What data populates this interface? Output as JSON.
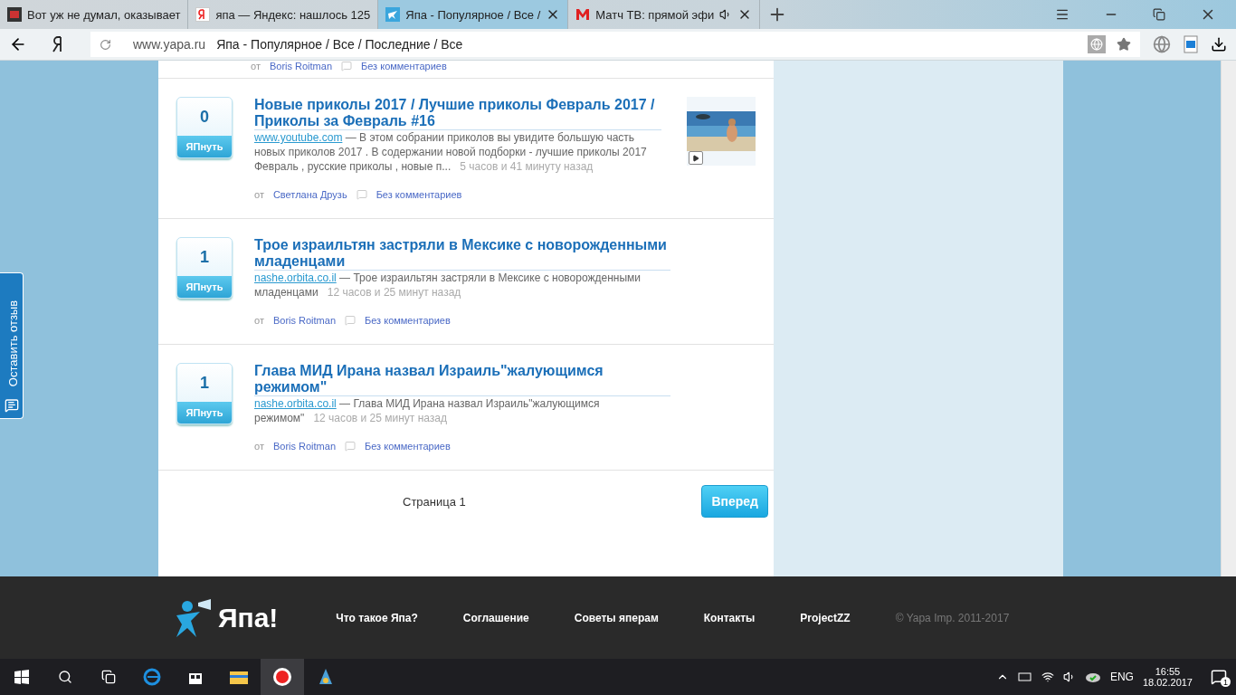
{
  "tabs": [
    {
      "title": "Вот уж не думал, оказывает",
      "selected": false,
      "kind": "yapa-dark"
    },
    {
      "title": "япа — Яндекс: нашлось 125",
      "selected": false,
      "kind": "yandex"
    },
    {
      "title": "Япа - Популярное / Все /",
      "selected": true,
      "kind": "yapa"
    },
    {
      "title": "Матч ТВ: прямой эфи",
      "selected": false,
      "kind": "match",
      "audio": true
    }
  ],
  "address": {
    "host": "www.yapa.ru",
    "title": "Япа - Популярное / Все / Последние / Все"
  },
  "top_meta": {
    "by": "от",
    "author": "Boris Roitman",
    "comments": "Без комментариев"
  },
  "posts": [
    {
      "votes": "0",
      "vote_label": "ЯПнуть",
      "title": "Новые приколы 2017 / Лучшие приколы Февраль 2017 / Приколы за Февраль #16",
      "source": "www.youtube.com",
      "text": " — В этом собрании приколов вы увидите большую часть новых приколов 2017 . В содержании новой подборки - лучшие приколы 2017 Февраль , русские приколы , новые п...",
      "time": "5 часов и 41 минуту назад",
      "by": "от",
      "author": "Светлана Друзь",
      "comments": "Без комментариев"
    },
    {
      "votes": "1",
      "vote_label": "ЯПнуть",
      "title": "Трое израильтян застряли в Мексике с новорожденными младенцами",
      "source": "nashe.orbita.co.il",
      "text": " — Трое израильтян застряли в Мексике с новорожденными младенцами",
      "time": "12 часов и 25 минут назад",
      "by": "от",
      "author": "Boris Roitman",
      "comments": "Без комментариев"
    },
    {
      "votes": "1",
      "vote_label": "ЯПнуть",
      "title": "Глава МИД Ирана назвал Израиль\"жалующимся режимом\"",
      "source": "nashe.orbita.co.il",
      "text": " — Глава МИД Ирана назвал Израиль\"жалующимся режимом\"",
      "time": "12 часов и 25 минут назад",
      "by": "от",
      "author": "Boris Roitman",
      "comments": "Без комментариев"
    }
  ],
  "pagination": {
    "page": "Страница 1",
    "next": "Вперед"
  },
  "feedback": "Оставить отзыв",
  "footer": {
    "logo": "Япа!",
    "links": [
      "Что такое Япа?",
      "Соглашение",
      "Советы яперам",
      "Контакты",
      "ProjectZZ"
    ],
    "copyright": "© Yapa Imp. 2011-2017"
  },
  "taskbar": {
    "lang": "ENG",
    "time": "16:55",
    "date": "18.02.2017",
    "notifications": "1"
  }
}
